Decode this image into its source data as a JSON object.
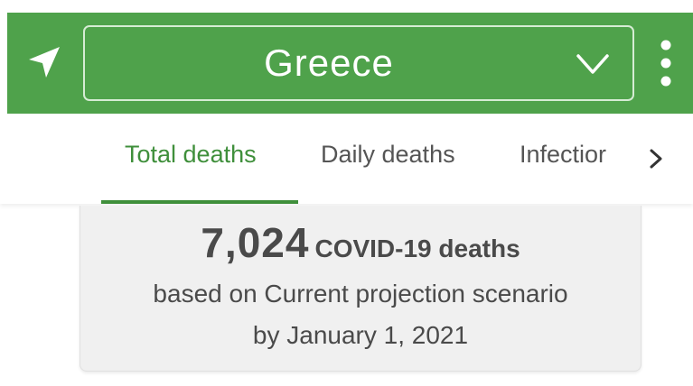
{
  "header": {
    "country": "Greece",
    "locate_icon": "navigation-arrow-icon",
    "dropdown_icon": "chevron-down-icon",
    "more_icon": "more-vertical-icon",
    "bar_color": "#4fa24b"
  },
  "tabs": {
    "items": [
      {
        "label": "Total deaths",
        "active": true
      },
      {
        "label": "Daily deaths",
        "active": false
      },
      {
        "label": "Infectior",
        "active": false
      }
    ],
    "next_icon": "chevron-right-icon",
    "active_color": "#3f8f3b"
  },
  "summary": {
    "death_count": "7,024",
    "death_label": "COVID-19 deaths",
    "scenario_line": "based on Current projection scenario",
    "date_line": "by January 1, 2021"
  }
}
